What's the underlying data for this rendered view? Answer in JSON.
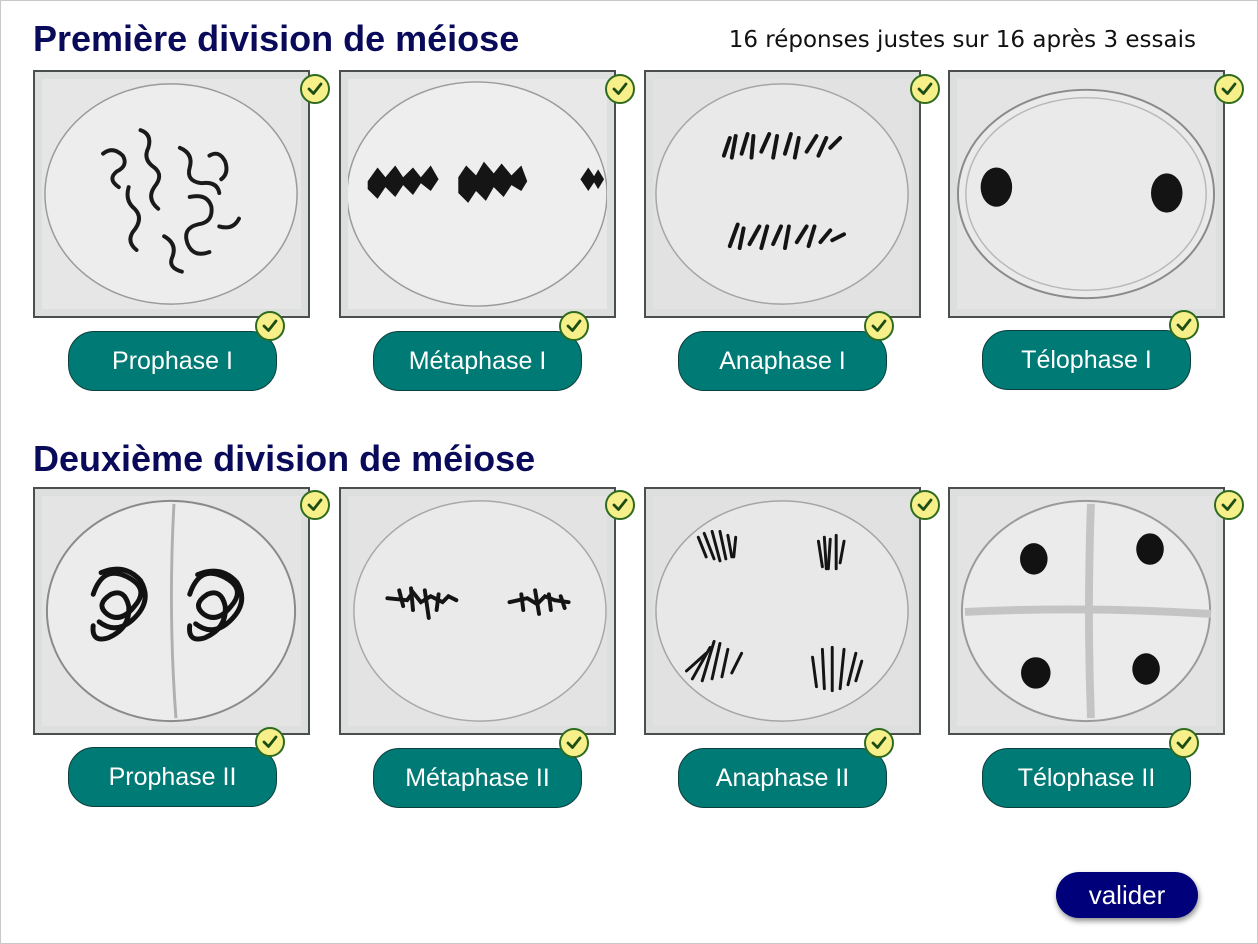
{
  "score_text": "16 réponses justes sur 16 après 3 essais",
  "sections": [
    {
      "title": "Première division de méiose",
      "items": [
        {
          "label": "Prophase I",
          "image_icon": "prophase-i-micrograph",
          "image_correct": true,
          "label_correct": true
        },
        {
          "label": "Métaphase I",
          "image_icon": "metaphase-i-micrograph",
          "image_correct": true,
          "label_correct": true
        },
        {
          "label": "Anaphase I",
          "image_icon": "anaphase-i-micrograph",
          "image_correct": true,
          "label_correct": true
        },
        {
          "label": "Télophase I",
          "image_icon": "telophase-i-micrograph",
          "image_correct": true,
          "label_correct": true
        }
      ]
    },
    {
      "title": "Deuxième division de méiose",
      "items": [
        {
          "label": "Prophase II",
          "image_icon": "prophase-ii-micrograph",
          "image_correct": true,
          "label_correct": true
        },
        {
          "label": "Métaphase II",
          "image_icon": "metaphase-ii-micrograph",
          "image_correct": true,
          "label_correct": true
        },
        {
          "label": "Anaphase II",
          "image_icon": "anaphase-ii-micrograph",
          "image_correct": true,
          "label_correct": true
        },
        {
          "label": "Télophase II",
          "image_icon": "telophase-ii-micrograph",
          "image_correct": true,
          "label_correct": true
        }
      ]
    }
  ],
  "validate_label": "valider",
  "colors": {
    "title": "#0a0a5a",
    "label_bg": "#007a74",
    "check_bg": "#f7f08a",
    "check_stroke": "#2e6b1e",
    "validate_bg": "#00007a"
  }
}
